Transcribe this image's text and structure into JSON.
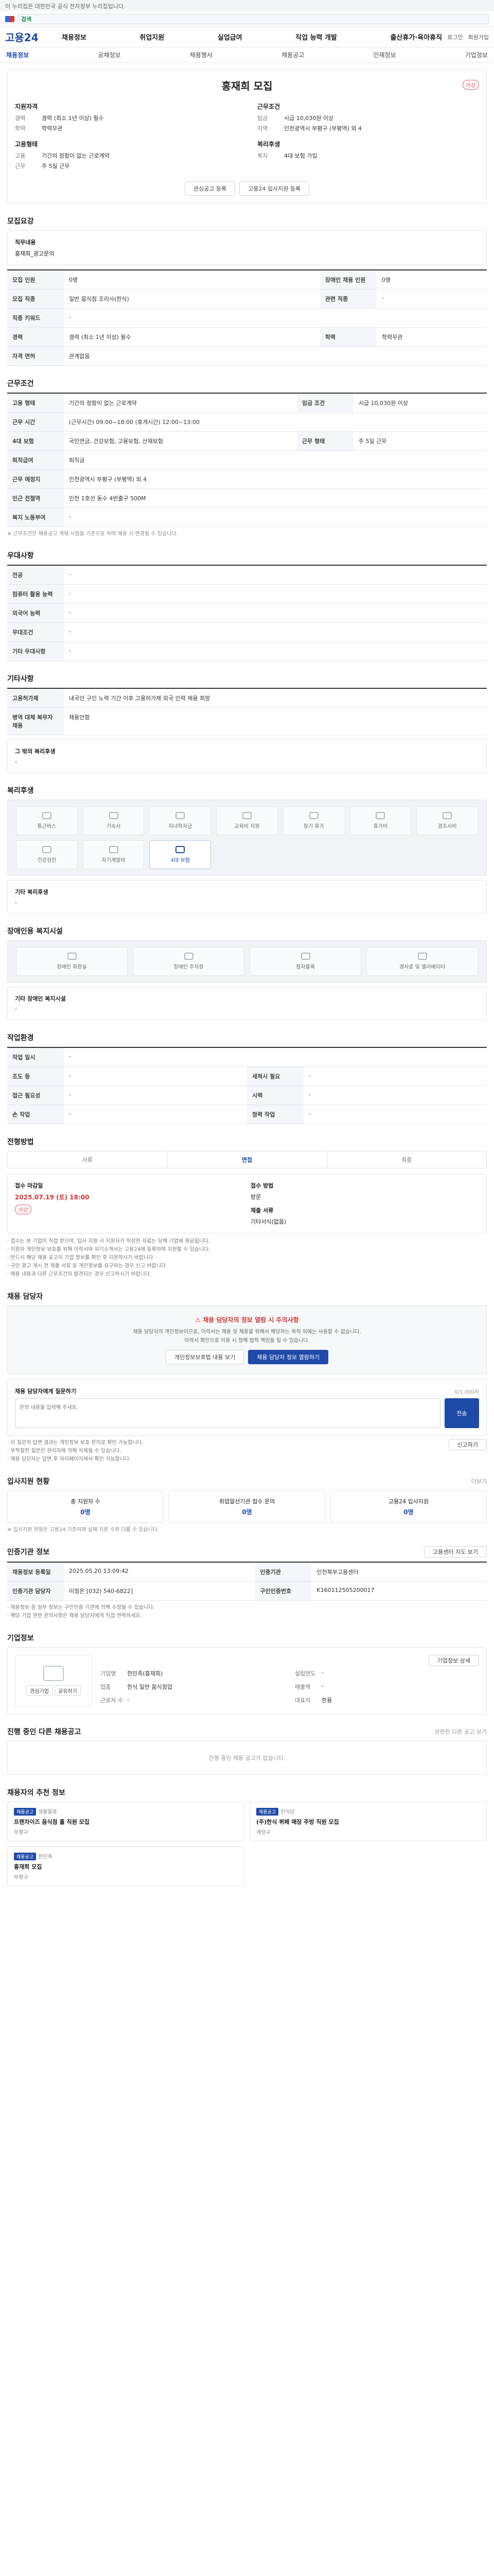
{
  "topbar": {
    "text": "이 누리집은 대한민국 공식 전자정부 누리집입니다."
  },
  "gov": {
    "search_prefix": "검색",
    "search_placeholder": ""
  },
  "header": {
    "logo": "고용24",
    "gnb": [
      "채용정보",
      "취업지원",
      "실업급여",
      "직업 능력 개발",
      "출산휴가·육아휴직"
    ],
    "util": [
      "로그인",
      "회원가입"
    ]
  },
  "subnav": [
    "채용정보",
    "공채정보",
    "채용행사",
    "채용공고",
    "인재정보",
    "기업정보"
  ],
  "posting": {
    "title": "홍재희 모집",
    "status": "마감",
    "summary_left_heading": "지원자격",
    "summary_right_heading": "근무조건",
    "summary_left": [
      {
        "k": "경력",
        "v": "경력 (최소 1년 이상) 필수"
      },
      {
        "k": "학력",
        "v": "학력무관"
      }
    ],
    "summary_right": [
      {
        "k": "임금",
        "v": "시급 10,030원 이상"
      },
      {
        "k": "지역",
        "v": "인천광역시 부평구 (부평역) 외 4"
      }
    ],
    "summary_left2_heading": "고용형태",
    "summary_left2": [
      {
        "k": "고용",
        "v": "기간의 정함이 없는 근로계약"
      },
      {
        "k": "근무",
        "v": "주 5일 근무"
      }
    ],
    "summary_right2_heading": "복리후생",
    "summary_right2": [
      {
        "k": "복지",
        "v": "4대 보험 가입"
      }
    ],
    "btn_scrap": "관심공고 등록",
    "btn_share": "고용24 입사지원 등록"
  },
  "recruit": {
    "heading": "모집요강",
    "job_label": "직무내용",
    "job_value": "홍재희_광고문의",
    "rows": [
      {
        "k1": "모집 인원",
        "v1": "0명",
        "k2": "장애인 채용 인원",
        "v2": "0명"
      },
      {
        "k1": "모집 직종",
        "v1": "일반 음식점 조리사(한식)",
        "k2": "관련 직종",
        "v2": "-"
      },
      {
        "k1": "직종 키워드",
        "v1": "-",
        "k2": "",
        "v2": ""
      },
      {
        "k1": "경력",
        "v1": "경력 (최소 1년 이상) 필수",
        "k2": "학력",
        "v2": "학력무관"
      },
      {
        "k1": "자격 면허",
        "v1": "관계없음",
        "k2": "",
        "v2": ""
      }
    ]
  },
  "conditions": {
    "heading": "근무조건",
    "rows": [
      {
        "k": "고용 형태",
        "v": "기간의 정함이 없는 근로계약",
        "k2": "임금 조건",
        "v2": "시급 10,030원 이상"
      },
      {
        "k": "근무 시간",
        "v": "(근무시간) 09:00~18:00 (휴게시간) 12:00~13:00",
        "k2": "",
        "v2": ""
      },
      {
        "k": "4대 보험",
        "v": "국민연금, 건강보험, 고용보험, 산재보험",
        "k2": "근무 형태",
        "v2": "주 5일 근무"
      },
      {
        "k": "퇴직급여",
        "v": "퇴직금",
        "k2": "",
        "v2": ""
      },
      {
        "k": "근무 예정지",
        "v": "인천광역시 부평구 (부평역) 외 4",
        "k2": "",
        "v2": ""
      },
      {
        "k": "인근 전철역",
        "v": "인천 1호선 동수 4번출구 500M",
        "k2": "",
        "v2": ""
      },
      {
        "k": "복지 노동부여",
        "v": "-",
        "k2": "",
        "v2": ""
      }
    ],
    "note": "※ 근무조건은 채용공고 게재 시점을 기준으로 하며 채용 시 변경될 수 있습니다."
  },
  "prefer": {
    "heading": "우대사항",
    "rows": [
      {
        "k": "전공",
        "v": "-"
      },
      {
        "k": "컴퓨터 활용 능력",
        "v": "-"
      },
      {
        "k": "외국어 능력",
        "v": "-"
      },
      {
        "k": "우대조건",
        "v": "-"
      },
      {
        "k": "기타 우대사항",
        "v": "-"
      }
    ]
  },
  "other": {
    "heading": "기타사항",
    "rows": [
      {
        "k": "고용허가제",
        "v": "내국인 구인 노력 기간 이후 고용허가제 외국 인력 채용 희망"
      },
      {
        "k": "병역 대체 복무자 채용",
        "v": "채용안함"
      }
    ],
    "extra_label": "그 밖의 복리후생",
    "extra_value": "-"
  },
  "welfare": {
    "heading": "복리후생",
    "items": [
      "통근버스",
      "기숙사",
      "자녀학자금",
      "교육비 지원",
      "장기 휴가",
      "휴가비",
      "경조사비",
      "건강검진",
      "자기계발비",
      "4대 보험"
    ],
    "active": [
      "4대 보험"
    ],
    "etc_label": "기타 복리후생",
    "etc_value": "-"
  },
  "disabled": {
    "heading": "장애인용 복지시설",
    "items": [
      "장애인 화장실",
      "장애인 주차장",
      "점자블록",
      "경사로 및 엘리베이터"
    ],
    "etc_label": "기타 장애인 복지시설",
    "etc_value": "-"
  },
  "env": {
    "heading": "작업환경",
    "rows": [
      {
        "k1": "작업 일시",
        "v1": "-",
        "k2": "",
        "v2": ""
      },
      {
        "k1": "조도 등",
        "v1": "-",
        "k2": "세척시 필요",
        "v2": "-"
      },
      {
        "k1": "접근 필요성",
        "v1": "-",
        "k2": "시력",
        "v2": "-"
      },
      {
        "k1": "손 작업",
        "v1": "-",
        "k2": "청력 작업",
        "v2": "-"
      }
    ]
  },
  "process": {
    "heading": "전형방법",
    "steps": [
      "서류",
      "면접",
      "최종"
    ],
    "active_step": "면접",
    "deadline_label": "접수 마감일",
    "deadline_value": "2025.07.19 (토) 18:00",
    "deadline_badge": "마감",
    "method_label": "접수 방법",
    "method_value": "방문",
    "docs_label": "제출 서류",
    "docs_value": "기타서식(없음)",
    "notes": [
      "접수는 본 기업이 직접 받으며, 입사 지원 시 지원자가 작성한 자료는 당해 기업에 제공됩니다.",
      "지원자 개인정보 보호를 위해 이력서와 자기소개서는 고용24에 등록하여 지원할 수 있습니다.",
      "반드시 해당 채용 공고의 기업 정보를 확인 후 지원하시기 바랍니다.",
      "구인 광고 게시 전 제출 서류 등 개인정보를 요구하는 경우 신고 바랍니다.",
      "채용 내용과 다른 근무조건이 발견되는 경우 신고하시기 바랍니다."
    ]
  },
  "contact": {
    "heading": "채용 담당자",
    "warn": "채용 담당자의 정보 열람 시 주의사항",
    "desc": "채용 담당자의 개인정보이므로, 이력서는 채용 및 채용을 위해서 해당하는 목적 외에는 사용할 수 없습니다.",
    "desc2": "이력서 확인으로 이용 시 정해 법적 책임을 질 수 있습니다.",
    "btn1": "개인정보보호법 내용 보기",
    "btn2": "채용 담당자 정보 열람하기",
    "qa_label": "채용 담당자에게 질문하기",
    "qa_count": "0/1,000자",
    "qa_placeholder": "문의 내용을 입력해 주세요.",
    "qa_btn": "전송",
    "notes": [
      "이 질문의 답변 결과는 개인정보 보호 문의로 확인 가능합니다.",
      "부적절한 질문은 관리자에 의해 삭제될 수 있습니다.",
      "채용 담당자는 답변 후 마이페이지에서 확인 가능합니다."
    ],
    "report_btn": "신고하기"
  },
  "status": {
    "heading": "입사지원 현황",
    "link": "더보기",
    "cards": [
      {
        "label": "총 지원자 수",
        "value": "0명"
      },
      {
        "label": "취업알선기관 접수 문의",
        "value": "0명"
      },
      {
        "label": "고용24 입사지원",
        "value": "0명"
      }
    ],
    "note": "※ 입사지원 현황은 고용24 기준이며 실제 지원 수와 다를 수 있습니다."
  },
  "agency": {
    "heading": "인증기관 정보",
    "btn": "고용센터 지도 보기",
    "rows": [
      {
        "k1": "채용정보 등록일",
        "v1": "2025.05.20 13:09:42",
        "k2": "인증기관",
        "v2": "인천북부고용센터"
      },
      {
        "k1": "인증기관 담당자",
        "v1": "이정은 [032) 540-6822]",
        "k2": "구인인증번호",
        "v2": "K160112505200017"
      }
    ],
    "notes": [
      "채용정보 중 일부 정보는 구인인증 기관에 의해 수정될 수 있습니다.",
      "해당 기업 관련 문의사항은 채용 담당자에게 직접 연락하세요."
    ]
  },
  "company": {
    "heading": "기업정보",
    "btn_more": "기업정보 상세",
    "btn_follow": "관심기업",
    "btn_share": "공유하기",
    "rows": [
      {
        "k1": "기업명",
        "v1": "한민족(홍재희)",
        "k2": "설립연도",
        "v2": "-"
      },
      {
        "k1": "업종",
        "v1": "한식 일반 음식점업",
        "k2": "매출액",
        "v2": "-"
      },
      {
        "k1": "근로자 수",
        "v1": "-",
        "k2": "대표자",
        "v2": "한용"
      }
    ]
  },
  "similar": {
    "heading": "진행 중인 다른 채용공고",
    "link": "관련된 다른 공고 보기",
    "empty": "진행 중인 채용 공고가 없습니다."
  },
  "reco": {
    "heading": "채용자의 추천 정보",
    "items": [
      {
        "tag": "채용공고",
        "title": "프랜차이즈 음식점 홀 직원 모집",
        "company": "생활물류",
        "region": "부평구"
      },
      {
        "tag": "채용공고",
        "title": "(주)한식 뷔페 매장 주방 직원 모집",
        "company": "한식당",
        "region": "계양구"
      },
      {
        "tag": "채용공고",
        "title": "홍재희 모집",
        "company": "한민족",
        "region": "부평구"
      }
    ]
  }
}
